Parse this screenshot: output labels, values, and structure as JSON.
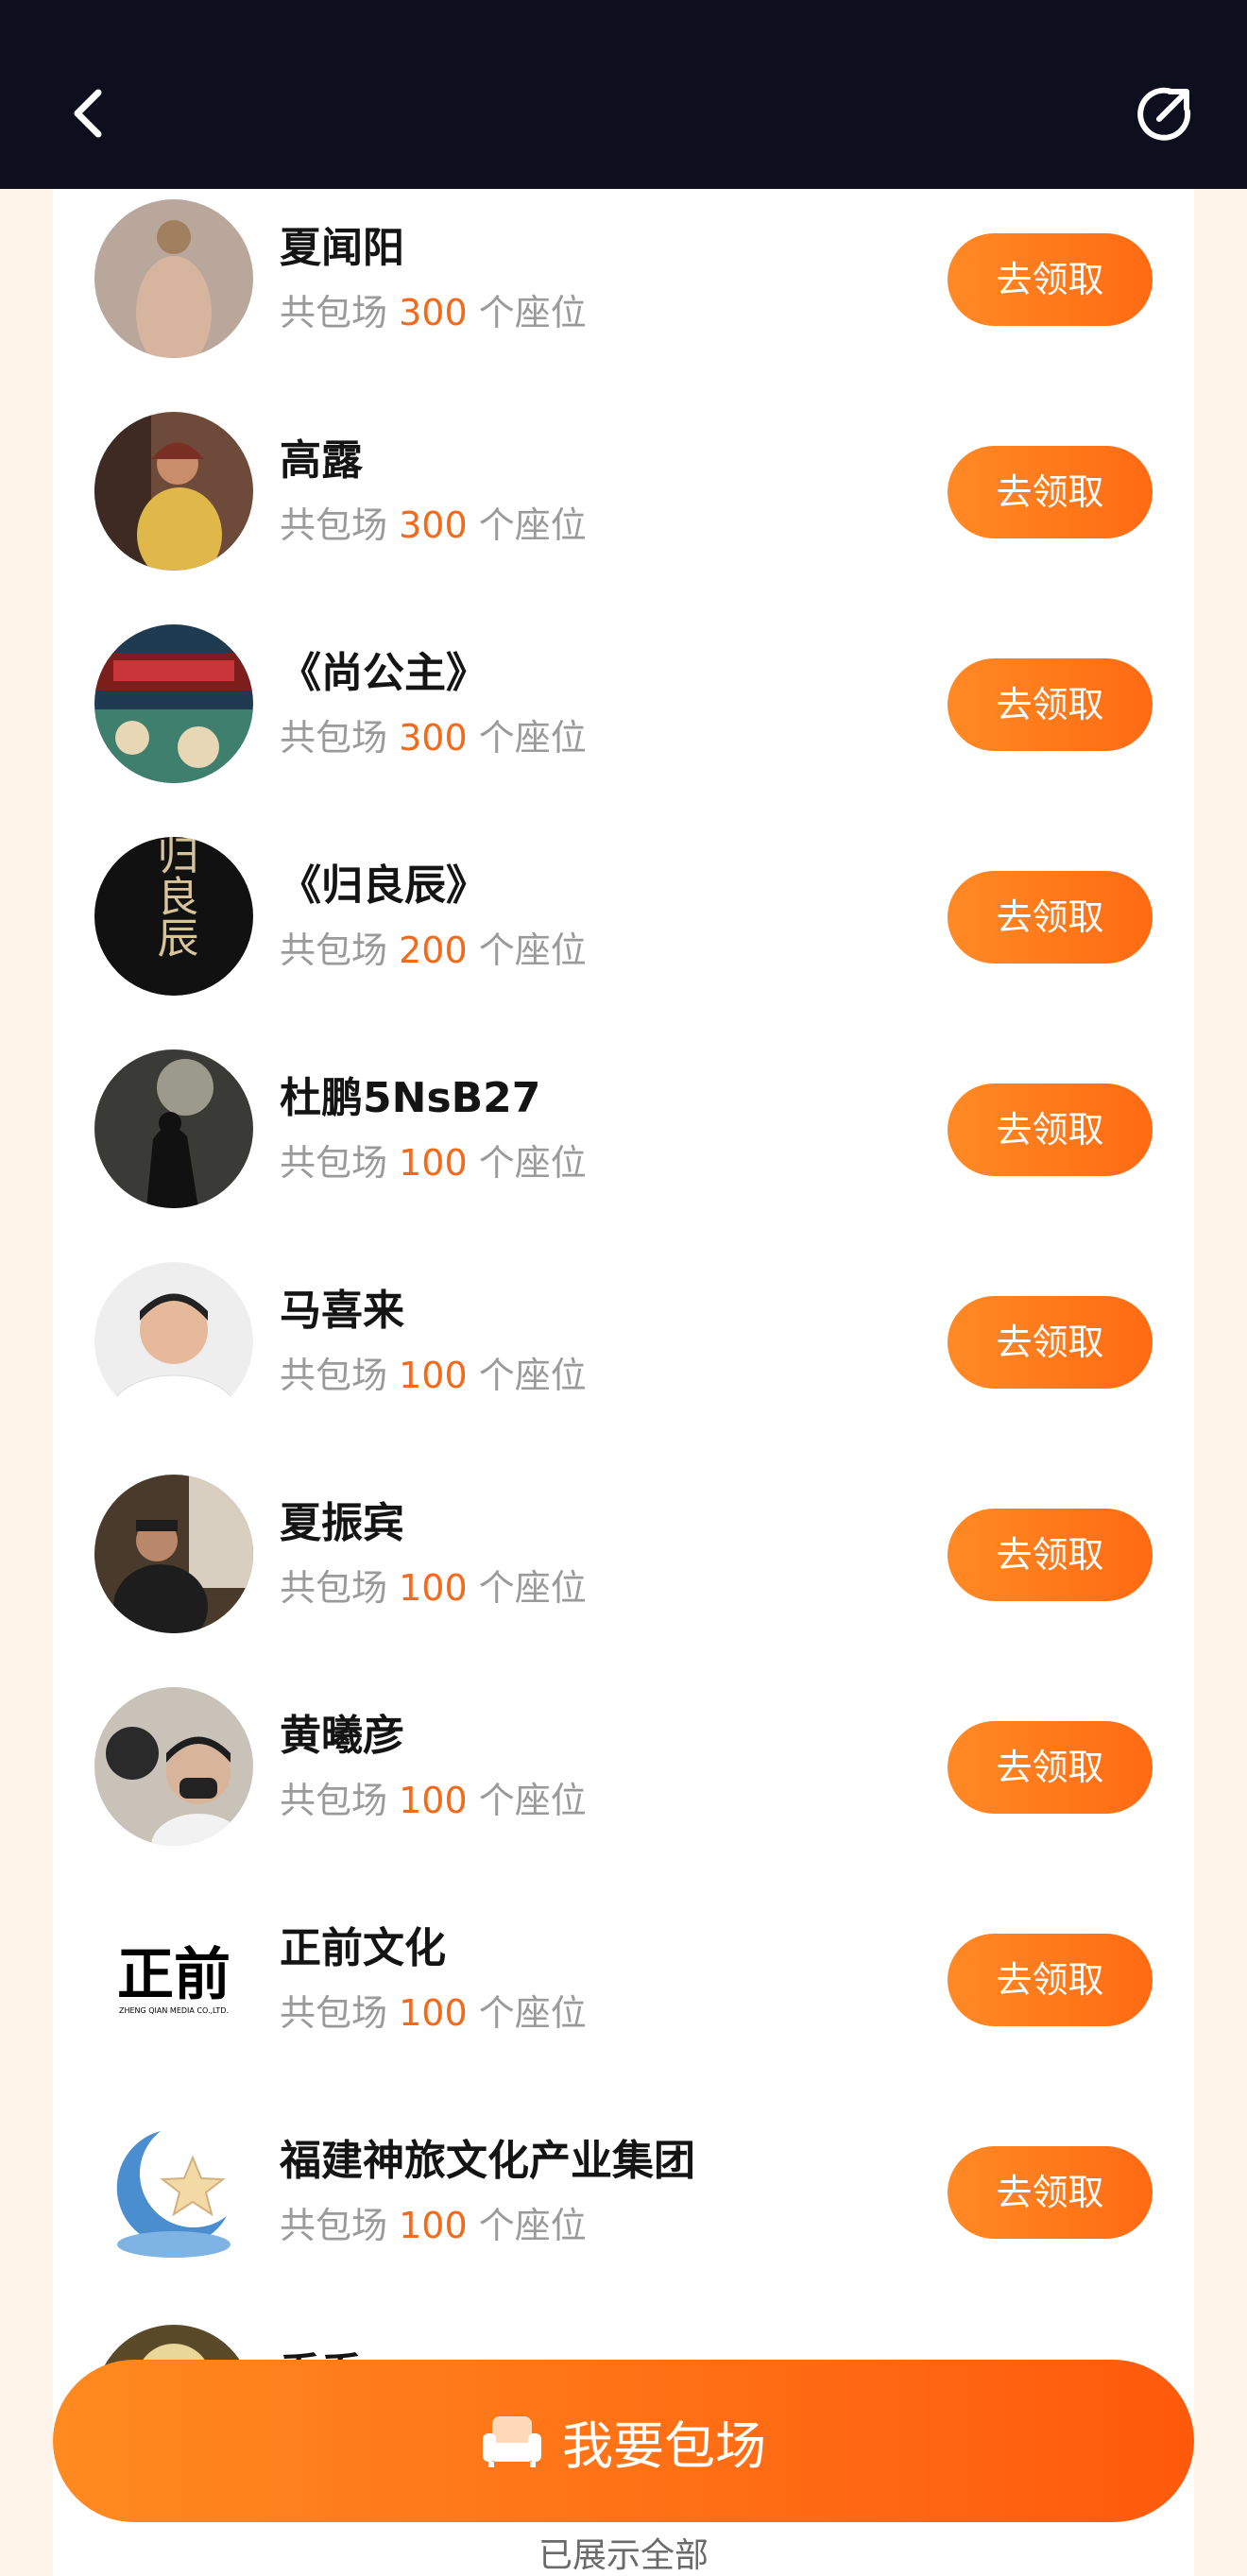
{
  "header": {
    "back_label": "返回",
    "share_label": "分享"
  },
  "list": {
    "seat_prefix": "共包场",
    "seat_suffix": "个座位",
    "claim_label": "去领取",
    "items": [
      {
        "name": "夏闻阳",
        "seats": "300"
      },
      {
        "name": "高露",
        "seats": "300"
      },
      {
        "name": "《尚公主》",
        "seats": "300"
      },
      {
        "name": "《归良辰》",
        "seats": "200"
      },
      {
        "name": "杜鹏5NsB27",
        "seats": "100"
      },
      {
        "name": "马喜来",
        "seats": "100"
      },
      {
        "name": "夏振宾",
        "seats": "100"
      },
      {
        "name": "黄曦彦",
        "seats": "100"
      },
      {
        "name": "正前文化",
        "seats": "100"
      },
      {
        "name": "福建神旅文化产业集团",
        "seats": "100"
      },
      {
        "name": "乔乔",
        "seats": ""
      }
    ]
  },
  "logos": {
    "zhengqian_mark": "正前",
    "zhengqian_sub": "ZHENG QIAN MEDIA CO.,LTD.",
    "guiliangchen_mark": "归良辰"
  },
  "footer": {
    "book_label": "我要包场",
    "show_all_label": "已展示全部"
  },
  "colors": {
    "accent": "#ff7a1a",
    "seat_number": "#f26a1b",
    "topbar": "#0e0f1e",
    "page_bg": "#fff4e9"
  }
}
